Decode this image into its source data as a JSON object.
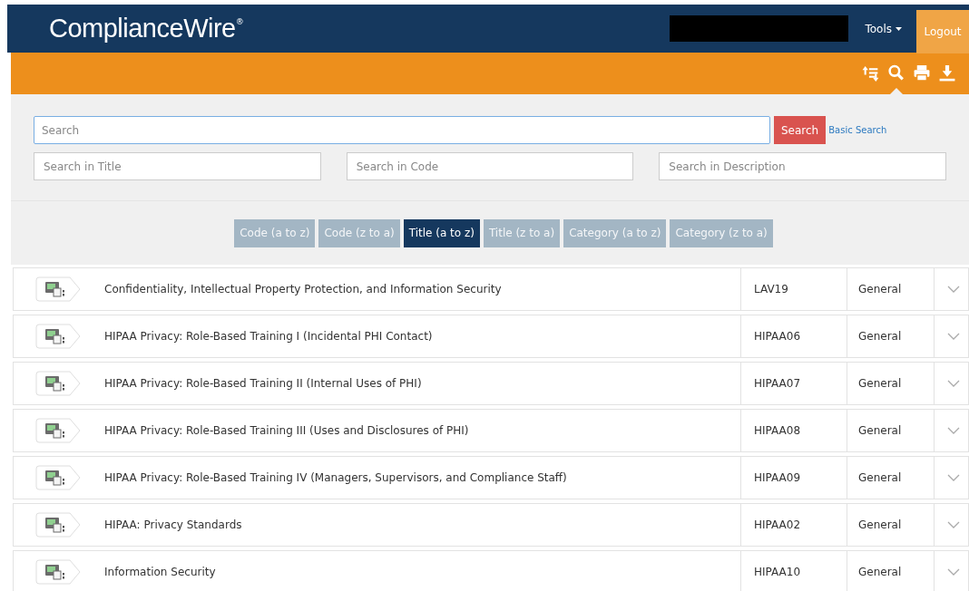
{
  "header": {
    "logo": "ComplianceWire",
    "logo_mark": "®",
    "menu": "Tools",
    "logout": "Logout"
  },
  "toolbar": {
    "tools": [
      {
        "selected": false
      },
      {
        "selected": true
      },
      {
        "selected": false
      },
      {
        "selected": false
      }
    ]
  },
  "search": {
    "main_placeholder": "Search",
    "button": "Search",
    "basic_search_link": "Basic Search",
    "fields": [
      {
        "placeholder": "Search in Title"
      },
      {
        "placeholder": "Search in Code"
      },
      {
        "placeholder": "Search in Description"
      }
    ]
  },
  "sort_buttons": [
    {
      "label": "Code (a to z)",
      "selected": false
    },
    {
      "label": "Code (z to a)",
      "selected": false
    },
    {
      "label": "Title (a to z)",
      "selected": true
    },
    {
      "label": "Title (z to a)",
      "selected": false
    },
    {
      "label": "Category (a to z)",
      "selected": false
    },
    {
      "label": "Category (z to a)",
      "selected": false
    }
  ],
  "rows": [
    {
      "title": "Confidentiality, Intellectual Property Protection, and Information Security",
      "code": "LAV19",
      "category": "General"
    },
    {
      "title": "HIPAA Privacy: Role-Based Training I (Incidental PHI Contact)",
      "code": "HIPAA06",
      "category": "General"
    },
    {
      "title": "HIPAA Privacy: Role-Based Training II (Internal Uses of PHI)",
      "code": "HIPAA07",
      "category": "General"
    },
    {
      "title": "HIPAA Privacy: Role-Based Training III (Uses and Disclosures of PHI)",
      "code": "HIPAA08",
      "category": "General"
    },
    {
      "title": "HIPAA Privacy: Role-Based Training IV (Managers, Supervisors, and Compliance Staff)",
      "code": "HIPAA09",
      "category": "General"
    },
    {
      "title": "HIPAA: Privacy Standards",
      "code": "HIPAA02",
      "category": "General"
    },
    {
      "title": "Information Security",
      "code": "HIPAA10",
      "category": "General"
    }
  ]
}
